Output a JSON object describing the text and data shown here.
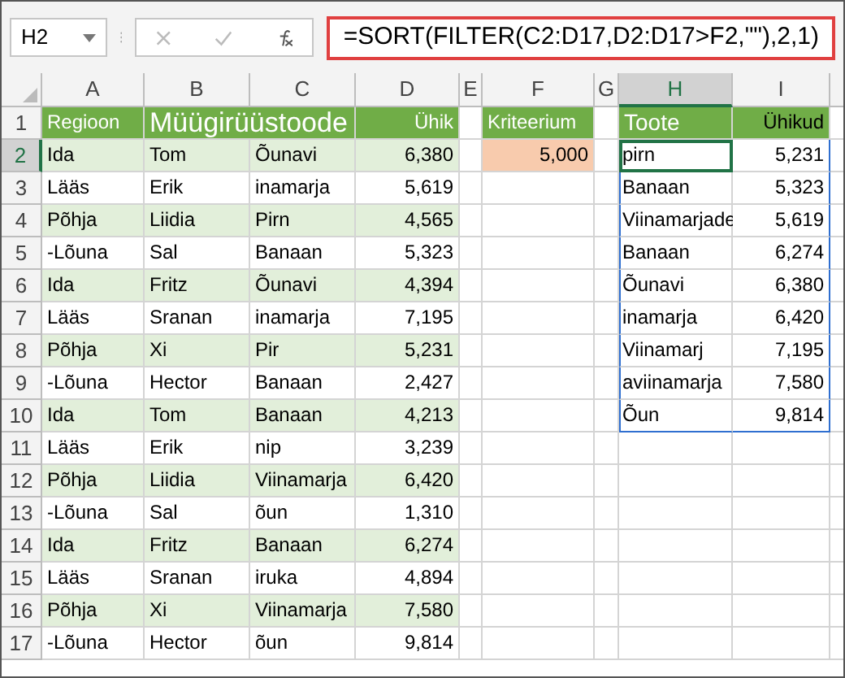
{
  "formula_bar": {
    "name_box": "H2",
    "formula": "=SORT(FILTER(C2:D17,D2:D17>F2,\"\"),2,1)"
  },
  "columns": [
    {
      "label": "A",
      "selected": false
    },
    {
      "label": "B",
      "selected": false
    },
    {
      "label": "C",
      "selected": false
    },
    {
      "label": "D",
      "selected": false
    },
    {
      "label": "E",
      "selected": false
    },
    {
      "label": "F",
      "selected": false
    },
    {
      "label": "G",
      "selected": false
    },
    {
      "label": "H",
      "selected": true
    },
    {
      "label": "I",
      "selected": false
    }
  ],
  "row_numbers": [
    {
      "label": "1",
      "selected": false
    },
    {
      "label": "2",
      "selected": true
    },
    {
      "label": "3",
      "selected": false
    },
    {
      "label": "4",
      "selected": false
    },
    {
      "label": "5",
      "selected": false
    },
    {
      "label": "6",
      "selected": false
    },
    {
      "label": "7",
      "selected": false
    },
    {
      "label": "8",
      "selected": false
    },
    {
      "label": "9",
      "selected": false
    },
    {
      "label": "10",
      "selected": false
    },
    {
      "label": "11",
      "selected": false
    },
    {
      "label": "12",
      "selected": false
    },
    {
      "label": "13",
      "selected": false
    },
    {
      "label": "14",
      "selected": false
    },
    {
      "label": "15",
      "selected": false
    },
    {
      "label": "16",
      "selected": false
    },
    {
      "label": "17",
      "selected": false
    }
  ],
  "table": {
    "header": [
      "Regioon",
      "Müügirüüstoode",
      "Ühik"
    ],
    "rows": [
      [
        "Ida",
        "Tom",
        "Õunavi",
        "6,380"
      ],
      [
        "Lääs",
        "Erik",
        "inamarja",
        "5,619"
      ],
      [
        "Põhja",
        "Liidia",
        "Pirn",
        "4,565"
      ],
      [
        "-Lõuna",
        "Sal",
        "Banaan",
        "5,323"
      ],
      [
        "Ida",
        "Fritz",
        "Õunavi",
        "4,394"
      ],
      [
        "Lääs",
        "Sranan",
        "inamarja",
        "7,195"
      ],
      [
        "Põhja",
        "Xi",
        "Pir",
        "5,231"
      ],
      [
        "-Lõuna",
        "Hector",
        "Banaan",
        "2,427"
      ],
      [
        "Ida",
        "Tom",
        "Banaan",
        "4,213"
      ],
      [
        "Lääs",
        "Erik",
        "nip",
        "3,239"
      ],
      [
        "Põhja",
        "Liidia",
        "Viinamarja",
        "6,420"
      ],
      [
        "-Lõuna",
        "Sal",
        "õun",
        "1,310"
      ],
      [
        "Ida",
        "Fritz",
        "Banaan",
        "6,274"
      ],
      [
        "Lääs",
        "Sranan",
        "iruka",
        "4,894"
      ],
      [
        "Põhja",
        "Xi",
        "Viinamarja",
        "7,580"
      ],
      [
        "-Lõuna",
        "Hector",
        "õun",
        "9,814"
      ]
    ]
  },
  "criteria": {
    "label": "Kriteerium",
    "value": "5,000"
  },
  "result": {
    "header": [
      "Toote",
      "Ühikud"
    ],
    "rows": [
      [
        "pirn",
        "5,231"
      ],
      [
        "Banaan",
        "5,323"
      ],
      [
        "Viinamarjade",
        "5,619"
      ],
      [
        "Banaan",
        "6,274"
      ],
      [
        "Õunavi",
        "6,380"
      ],
      [
        "inamarja",
        "6,420"
      ],
      [
        "Viinamarj",
        "7,195"
      ],
      [
        "aviinamarja",
        "7,580"
      ],
      [
        "Õun",
        "9,814"
      ]
    ]
  }
}
